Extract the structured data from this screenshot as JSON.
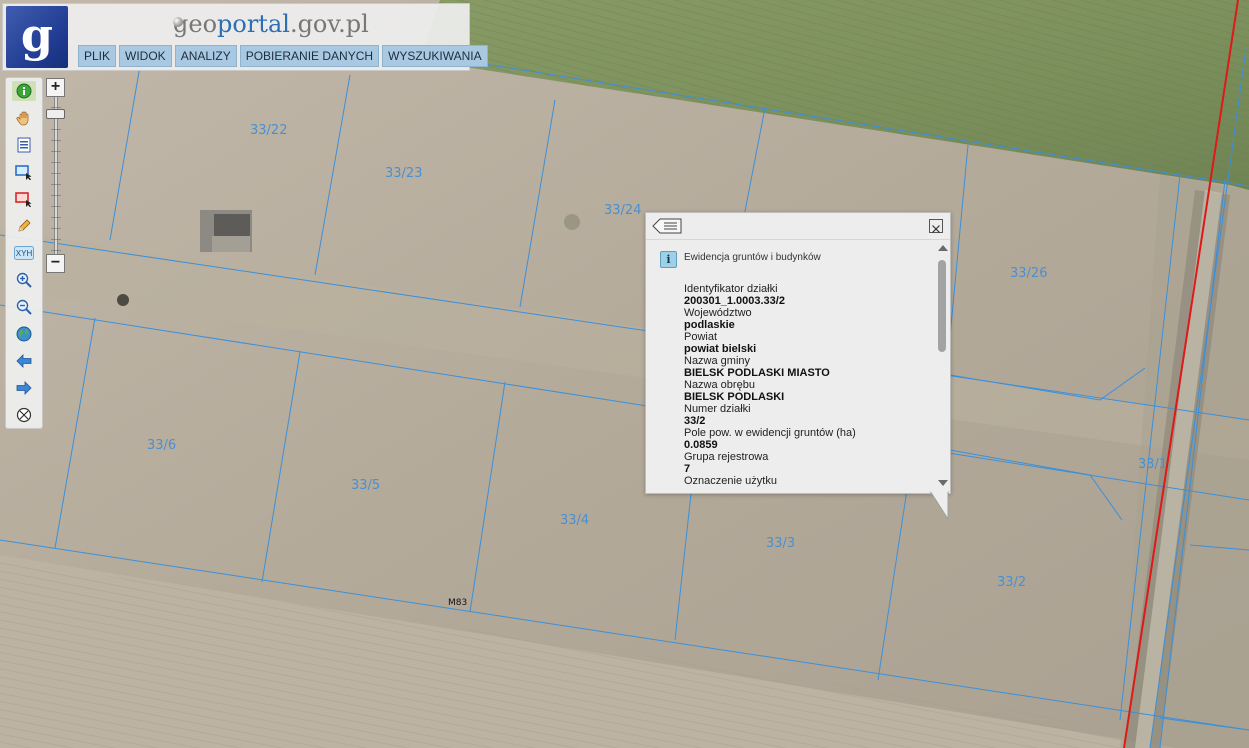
{
  "header": {
    "logo_letter": "g",
    "site_title_prefix": "geo",
    "site_title_accent": "portal",
    "site_title_suffix": ".gov.pl",
    "menu": [
      "PLIK",
      "WIDOK",
      "ANALIZY",
      "POBIERANIE DANYCH",
      "WYSZUKIWANIA"
    ]
  },
  "toolbar": {
    "tools": [
      "info-icon",
      "pan-hand-icon",
      "legend-icon",
      "select-rectangle-icon",
      "deselect-rectangle-icon",
      "draw-pencil-icon",
      "xyh-coordinates-icon",
      "zoom-in-icon",
      "zoom-out-icon",
      "full-extent-globe-icon",
      "previous-view-icon",
      "next-view-icon",
      "clear-icon"
    ],
    "xyh_label": "XYH",
    "zoom_in_label": "+",
    "zoom_out_label": "−",
    "zoom_level_fraction": 0.08
  },
  "map": {
    "parcel_labels": [
      "33/22",
      "33/23",
      "33/24",
      "33/26",
      "33/6",
      "33/5",
      "33/4",
      "33/3",
      "33/2",
      "33/1"
    ],
    "boundary_point_label": "M83",
    "colors": {
      "parcel_line": "#3d8fd9",
      "road_line": "#e01818",
      "parcel_label": "#4a8fd0"
    }
  },
  "popup": {
    "layer_title": "Ewidencja gruntów i budynków",
    "fields": [
      {
        "label": "Identyfikator działki",
        "value": "200301_1.0003.33/2"
      },
      {
        "label": "Województwo",
        "value": "podlaskie"
      },
      {
        "label": "Powiat",
        "value": "powiat bielski"
      },
      {
        "label": "Nazwa gminy",
        "value": "BIELSK PODLASKI MIASTO"
      },
      {
        "label": "Nazwa obrębu",
        "value": "BIELSK PODLASKI"
      },
      {
        "label": "Numer działki",
        "value": "33/2"
      },
      {
        "label": "Pole pow. w ewidencji gruntów (ha)",
        "value": "0.0859"
      },
      {
        "label": "Grupa rejestrowa",
        "value": "7"
      },
      {
        "label": "Oznaczenie użytku",
        "value": ""
      }
    ]
  }
}
